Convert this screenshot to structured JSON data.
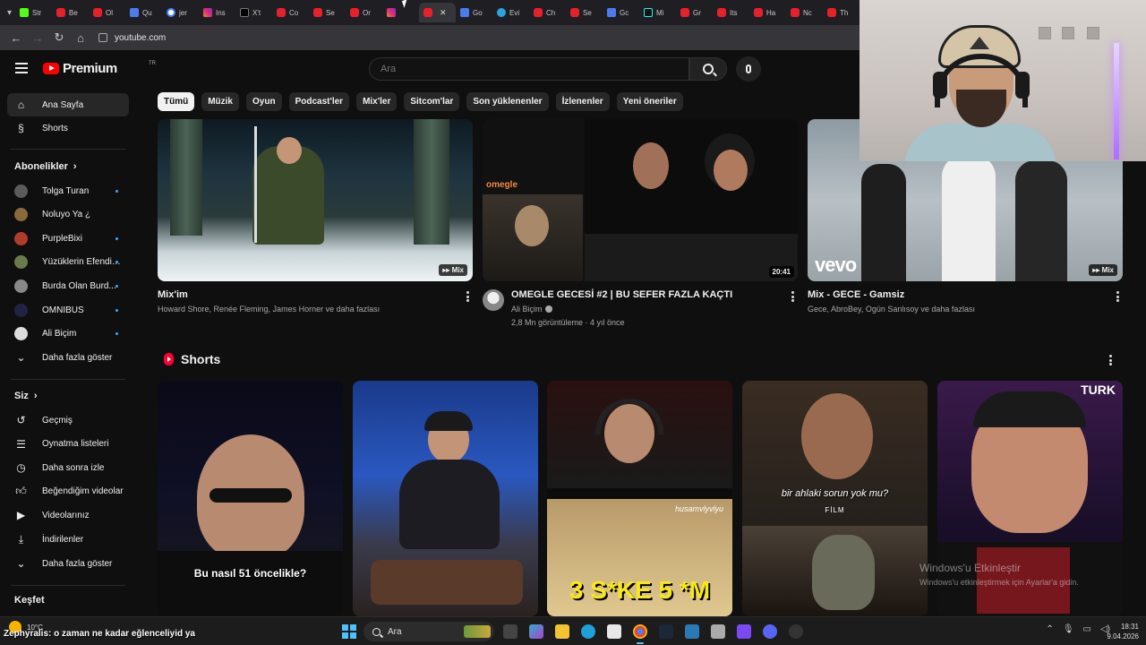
{
  "browser": {
    "tabs": [
      {
        "label": "Str",
        "icon": "kick-icon",
        "fav": "k"
      },
      {
        "label": "Be",
        "icon": "youtube-icon",
        "fav": "yt"
      },
      {
        "label": "Ol",
        "icon": "youtube-icon",
        "fav": "yt"
      },
      {
        "label": "Qu",
        "icon": "ai-icon",
        "fav": "ai"
      },
      {
        "label": "jer",
        "icon": "google-icon",
        "fav": "g"
      },
      {
        "label": "Ins",
        "icon": "instagram-icon",
        "fav": "ig"
      },
      {
        "label": "X't",
        "icon": "x-icon",
        "fav": "x"
      },
      {
        "label": "Co",
        "icon": "youtube-icon",
        "fav": "yt"
      },
      {
        "label": "Se",
        "icon": "youtube-icon",
        "fav": "yt"
      },
      {
        "label": "Or",
        "icon": "youtube-icon",
        "fav": "yt"
      },
      {
        "label": "",
        "icon": "instagram-icon",
        "fav": "ig"
      },
      {
        "label": "",
        "icon": "youtube-icon",
        "fav": "yt",
        "active": true
      },
      {
        "label": "Go",
        "icon": "ai-icon",
        "fav": "ai"
      },
      {
        "label": "Evi",
        "icon": "telegram-icon",
        "fav": "tg"
      },
      {
        "label": "Ch",
        "icon": "youtube-icon",
        "fav": "yt"
      },
      {
        "label": "Se",
        "icon": "youtube-icon",
        "fav": "yt"
      },
      {
        "label": "Gc",
        "icon": "ai-icon",
        "fav": "ai"
      },
      {
        "label": "Mi",
        "icon": "tiktok-icon",
        "fav": "tt"
      },
      {
        "label": "Gr",
        "icon": "youtube-icon",
        "fav": "yt"
      },
      {
        "label": "Its",
        "icon": "youtube-icon",
        "fav": "yt"
      },
      {
        "label": "Ha",
        "icon": "youtube-icon",
        "fav": "yt"
      },
      {
        "label": "Nc",
        "icon": "youtube-icon",
        "fav": "yt"
      },
      {
        "label": "Th",
        "icon": "youtube-icon",
        "fav": "yt"
      }
    ],
    "url": "youtube.com"
  },
  "header": {
    "logo": "Premium",
    "region": "TR",
    "search_placeholder": "Ara"
  },
  "sidebar": {
    "home": "Ana Sayfa",
    "shorts": "Shorts",
    "subscriptions_heading": "Abonelikler",
    "subscriptions": [
      {
        "name": "Tolga Turan",
        "color": "#5b5b5b",
        "new": true
      },
      {
        "name": "Noluyo Ya ¿",
        "color": "#8a6a3a",
        "new": false
      },
      {
        "name": "PurpleBixi",
        "color": "#b23b2b",
        "new": true
      },
      {
        "name": "Yüzüklerin Efendisi ...",
        "color": "#6b7a4a",
        "new": true
      },
      {
        "name": "Burda Olan Burd...",
        "color": "#888888",
        "new": true
      },
      {
        "name": "OMNIBUS",
        "color": "#222244",
        "new": true
      },
      {
        "name": "Ali Biçim",
        "color": "#dddddd",
        "new": true
      }
    ],
    "show_more_1": "Daha fazla göster",
    "you_heading": "Siz",
    "you_items": [
      {
        "label": "Geçmiş",
        "icon": "history-icon"
      },
      {
        "label": "Oynatma listeleri",
        "icon": "playlists-icon"
      },
      {
        "label": "Daha sonra izle",
        "icon": "watch-later-icon"
      },
      {
        "label": "Beğendiğim videolar",
        "icon": "like-icon"
      },
      {
        "label": "Videolarınız",
        "icon": "your-videos-icon"
      },
      {
        "label": "İndirilenler",
        "icon": "download-icon"
      }
    ],
    "show_more_2": "Daha fazla göster",
    "explore_heading": "Keşfet"
  },
  "chips": [
    "Tümü",
    "Müzik",
    "Oyun",
    "Podcast'ler",
    "Mix'ler",
    "Sitcom'lar",
    "Son yüklenenler",
    "İzlenenler",
    "Yeni öneriler"
  ],
  "videos": [
    {
      "title": "Mix'im",
      "sub": "Howard Shore, Renée Fleming, James Horner ve daha fazlası",
      "badge": "Mix"
    },
    {
      "title": "OMEGLE GECESİ #2 | BU SEFER FAZLA KAÇTI",
      "channel": "Ali Biçim",
      "stats": "2,8 Mn görüntüleme · 4 yıl önce",
      "duration": "20:41",
      "omegle_text": "omegle"
    },
    {
      "title": "Mix - GECE - Gamsiz",
      "sub": "Gece, AbroBey, Ogün Sanlısoy ve daha fazlası",
      "badge": "Mix",
      "vevo": "vevo"
    }
  ],
  "shorts": {
    "heading": "Shorts",
    "items": [
      {
        "caption": "Bu nasıl 51 öncelikle?"
      },
      {
        "caption": ""
      },
      {
        "caption": "3 S*KE 5 *M",
        "top_text": "husamvlyvlyu"
      },
      {
        "caption": "bir ahlaki sorun yok mu?",
        "logo": "FİLM"
      },
      {
        "caption": "",
        "corner": "TURK"
      }
    ]
  },
  "watermark": {
    "line1": "Windows'u Etkinleştir",
    "line2": "Windows'u etkinleştirmek için Ayarlar'a gidin."
  },
  "taskbar": {
    "temp": "10°C",
    "ticker_brand": "Zephyralis",
    "ticker_text": ": o zaman ne kadar eğlenceliyid ya",
    "search": "Ara",
    "time": "18:31",
    "date": "9.04.2026"
  },
  "colors": {
    "background": "#0f0f0f",
    "youtube_red": "#ff0000",
    "chip_bg": "#272727",
    "accent_blue": "#3ea6ff"
  }
}
